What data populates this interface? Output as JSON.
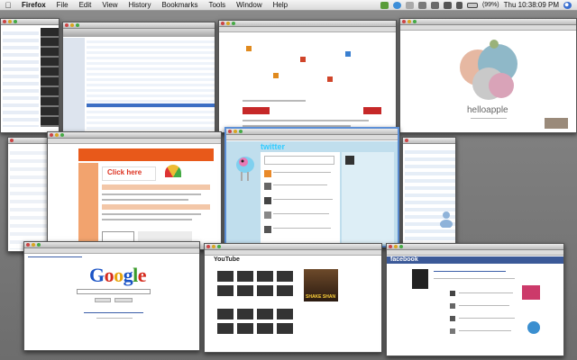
{
  "menubar": {
    "apple_glyph": "",
    "app_name": "Firefox",
    "menus": [
      "File",
      "Edit",
      "View",
      "History",
      "Bookmarks",
      "Tools",
      "Window",
      "Help"
    ],
    "battery": "(99%)",
    "clock": "Thu 10:38:09 PM"
  },
  "windows": {
    "helloapple": {
      "title": "helloapple"
    },
    "twitter": {
      "logo": "twitter"
    },
    "shoutcast": {
      "banner": "Click here"
    },
    "google": {
      "logo": [
        "G",
        "o",
        "o",
        "g",
        "l",
        "e"
      ]
    },
    "youtube": {
      "logo": "YouTube",
      "video_caption": "SHAKE SHAN"
    },
    "facebook": {
      "logo": "facebook"
    }
  },
  "colors": {
    "active_border": "#5c8fd6",
    "twitter_blue": "#33ccff",
    "facebook_blue": "#3b5998",
    "youtube_red": "#cc0000"
  }
}
